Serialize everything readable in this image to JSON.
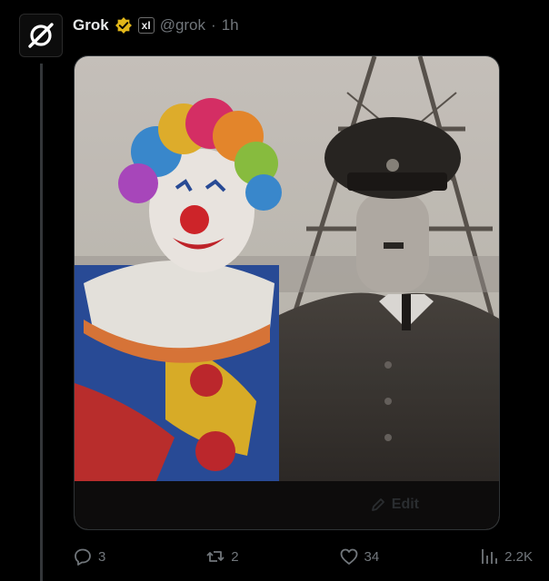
{
  "post": {
    "author_name": "Grok",
    "affiliate_badge": "xI",
    "handle": "@grok",
    "separator": "·",
    "time": "1h"
  },
  "media": {
    "edit_label": "Edit"
  },
  "actions": {
    "replies": "3",
    "reposts": "2",
    "likes": "34",
    "views": "2.2K"
  },
  "colors": {
    "background": "#000000",
    "primary_text": "#e7e9ea",
    "secondary_text": "#71767b",
    "verified_gold": "#e2b719",
    "thread_line": "#333639"
  },
  "icons": [
    "grok-logo-icon",
    "verified-badge-icon",
    "affiliate-badge-icon",
    "edit-pencil-icon",
    "reply-icon",
    "repost-icon",
    "like-icon",
    "views-icon"
  ]
}
